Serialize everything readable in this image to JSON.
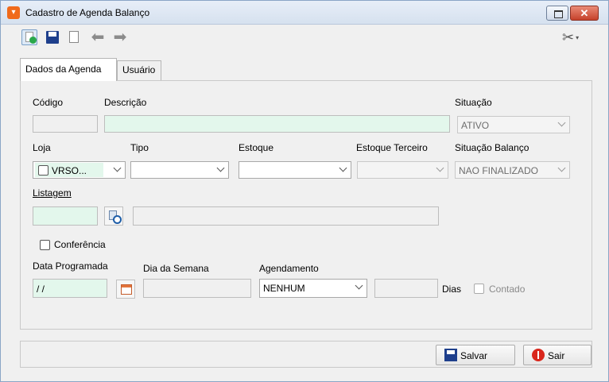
{
  "window": {
    "title": "Cadastro de Agenda Balanço",
    "app_icon": "▾"
  },
  "toolbar": {
    "icons": [
      "new-document-icon",
      "save-disk-icon",
      "copy-document-icon",
      "back-arrow-icon",
      "forward-arrow-icon",
      "tools-icon"
    ],
    "back_glyph": "⬅",
    "forward_glyph": "➡",
    "tools_glyph": "✂",
    "tools_dropdown": "▾"
  },
  "tabs": [
    {
      "label": "Dados da Agenda",
      "active": true
    },
    {
      "label": "Usuário",
      "active": false
    }
  ],
  "form": {
    "codigo": {
      "label": "Código",
      "value": ""
    },
    "descricao": {
      "label": "Descrição",
      "value": ""
    },
    "situacao": {
      "label": "Situação",
      "value": "ATIVO"
    },
    "loja": {
      "label": "Loja",
      "value": "VRSO..."
    },
    "tipo": {
      "label": "Tipo",
      "value": ""
    },
    "estoque": {
      "label": "Estoque",
      "value": ""
    },
    "estoque_terceiro": {
      "label": "Estoque Terceiro",
      "value": ""
    },
    "situacao_balanco": {
      "label": "Situação Balanço",
      "value": "NAO FINALIZADO"
    },
    "listagem": {
      "label": "Listagem",
      "code": "",
      "description": ""
    },
    "conferencia": {
      "label": "Conferência",
      "checked": false
    },
    "data_programada": {
      "label": "Data Programada",
      "value": " / /"
    },
    "dia_semana": {
      "label": "Dia da Semana",
      "value": ""
    },
    "agendamento": {
      "label": "Agendamento",
      "value": "NENHUM"
    },
    "dias": {
      "label": "Dias",
      "value": ""
    },
    "contado": {
      "label": "Contado",
      "checked": false
    }
  },
  "actions": {
    "save_label": "Salvar",
    "exit_label": "Sair"
  },
  "colors": {
    "required_field_bg": "#e3f7ec",
    "title_bar": "#dce6f2",
    "close_button": "#c6422b",
    "app_icon": "#f06a1b"
  }
}
